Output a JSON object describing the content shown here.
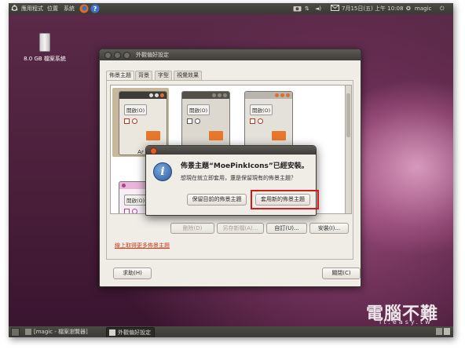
{
  "top_panel": {
    "menu_apps": "應用程式",
    "menu_places": "位置",
    "menu_system": "系統",
    "clock": "7月15日(五) 上午 10:08",
    "user": "magic"
  },
  "desktop": {
    "drive_label": "8.0 GB 檔案系統"
  },
  "window": {
    "title": "外觀偏好設定",
    "tabs": [
      "佈景主題",
      "背景",
      "字型",
      "視覺效果"
    ],
    "thumbnails": [
      {
        "open_label": "開啟(O)",
        "label": "Ar"
      },
      {
        "open_label": "開啟(O)",
        "label": ""
      },
      {
        "open_label": "開啟(O)",
        "label": ""
      },
      {
        "open_label": "開啟(O)",
        "label": ""
      }
    ],
    "buttons": {
      "delete": "刪除(D)",
      "save_as": "另存新檔(A)...",
      "customize": "自訂(U)...",
      "install": "安裝(I)..."
    },
    "online_link": "線上取得更多佈景主題",
    "help": "求助(H)",
    "close": "關閉(C)"
  },
  "dialog": {
    "heading": "佈景主題“MoePinkIcons”已經安裝。",
    "message": "想現在就立即套用，還是保留現有的佈景主題？",
    "keep_button": "保留目前的佈景主題",
    "apply_button": "套用新的佈景主題"
  },
  "taskbar": {
    "items": [
      "[magic - 檔案瀏覽器]",
      "外觀偏好設定"
    ]
  },
  "watermark": {
    "text": "電腦不難",
    "url": "it.easy.tw"
  },
  "colors": {
    "highlight": "#d41a1a",
    "link": "#d23a1a",
    "accent_orange": "#e6772e"
  }
}
